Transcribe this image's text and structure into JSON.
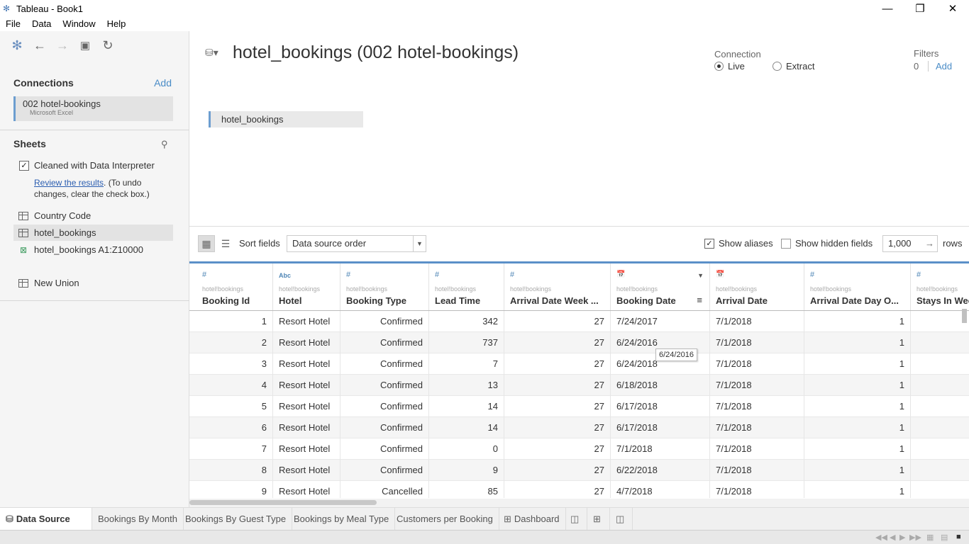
{
  "window": {
    "title": "Tableau - Book1"
  },
  "menu": [
    "File",
    "Data",
    "Window",
    "Help"
  ],
  "connections": {
    "heading": "Connections",
    "add_label": "Add",
    "items": [
      {
        "name": "002 hotel-bookings",
        "type": "Microsoft Excel"
      }
    ]
  },
  "sheets": {
    "heading": "Sheets",
    "interpreter_label": "Cleaned with Data Interpreter",
    "interpreter_checked": true,
    "review_link": "Review the results",
    "review_note": ". (To undo",
    "review_note2": "changes, clear the check box.)",
    "items": [
      "Country Code",
      "hotel_bookings",
      "hotel_bookings A1:Z10000"
    ],
    "new_union": "New Union"
  },
  "header": {
    "title": "hotel_bookings (002 hotel-bookings)",
    "connection_label": "Connection",
    "live_label": "Live",
    "extract_label": "Extract",
    "filters_label": "Filters",
    "filters_count": "0",
    "filters_add": "Add"
  },
  "canvas": {
    "table_name": "hotel_bookings"
  },
  "grid_toolbar": {
    "sort_label": "Sort fields",
    "sort_value": "Data source order",
    "show_aliases": "Show aliases",
    "show_hidden": "Show hidden fields",
    "rows_value": "1,000",
    "rows_label": "rows"
  },
  "columns": [
    {
      "type": "#",
      "source": "hotel!bookings",
      "name": "Booking Id"
    },
    {
      "type": "Abc",
      "source": "hotel!bookings",
      "name": "Hotel"
    },
    {
      "type": "#",
      "source": "hotel!bookings",
      "name": "Booking Type"
    },
    {
      "type": "#",
      "source": "hotel!bookings",
      "name": "Lead Time"
    },
    {
      "type": "#",
      "source": "hotel!bookings",
      "name": "Arrival Date Week ..."
    },
    {
      "type": "📅",
      "source": "hotel!bookings",
      "name": "Booking Date"
    },
    {
      "type": "📅",
      "source": "hotel!bookings",
      "name": "Arrival Date"
    },
    {
      "type": "#",
      "source": "hotel!bookings",
      "name": "Arrival Date Day O..."
    },
    {
      "type": "#",
      "source": "hotel!bookings",
      "name": "Stays In Wee"
    }
  ],
  "rows": [
    [
      "1",
      "Resort Hotel",
      "Confirmed",
      "342",
      "27",
      "7/24/2017",
      "7/1/2018",
      "1",
      ""
    ],
    [
      "2",
      "Resort Hotel",
      "Confirmed",
      "737",
      "27",
      "6/24/2016",
      "7/1/2018",
      "1",
      ""
    ],
    [
      "3",
      "Resort Hotel",
      "Confirmed",
      "7",
      "27",
      "6/24/2018",
      "7/1/2018",
      "1",
      ""
    ],
    [
      "4",
      "Resort Hotel",
      "Confirmed",
      "13",
      "27",
      "6/18/2018",
      "7/1/2018",
      "1",
      ""
    ],
    [
      "5",
      "Resort Hotel",
      "Confirmed",
      "14",
      "27",
      "6/17/2018",
      "7/1/2018",
      "1",
      ""
    ],
    [
      "6",
      "Resort Hotel",
      "Confirmed",
      "14",
      "27",
      "6/17/2018",
      "7/1/2018",
      "1",
      ""
    ],
    [
      "7",
      "Resort Hotel",
      "Confirmed",
      "0",
      "27",
      "7/1/2018",
      "7/1/2018",
      "1",
      ""
    ],
    [
      "8",
      "Resort Hotel",
      "Confirmed",
      "9",
      "27",
      "6/22/2018",
      "7/1/2018",
      "1",
      ""
    ],
    [
      "9",
      "Resort Hotel",
      "Cancelled",
      "85",
      "27",
      "4/7/2018",
      "7/1/2018",
      "1",
      ""
    ]
  ],
  "tooltip": "6/24/2016",
  "tabs": [
    "Data Source",
    "Bookings By Month",
    "Bookings By Guest Type",
    "Bookings by Meal Type",
    "Customers per Booking",
    "Dashboard"
  ]
}
